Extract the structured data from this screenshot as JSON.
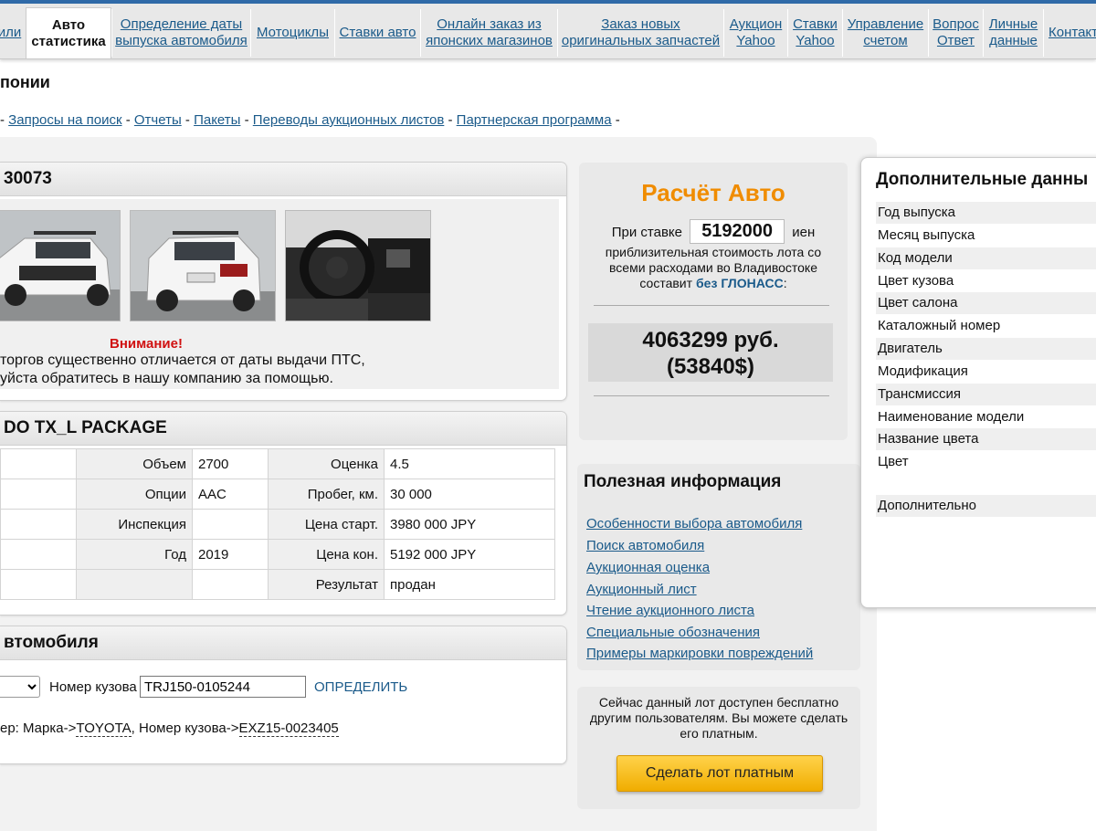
{
  "nav": [
    {
      "label": "или"
    },
    {
      "label": "Авто статистика"
    },
    {
      "label": "Определение даты выпуска автомобиля"
    },
    {
      "label": "Мотоциклы"
    },
    {
      "label": "Ставки авто"
    },
    {
      "label": "Онлайн заказ из японских магазинов"
    },
    {
      "label": "Заказ новых оригинальных запчастей"
    },
    {
      "label": "Аукцион Yahoo"
    },
    {
      "label": "Ставки Yahoo"
    },
    {
      "label": "Управление счетом"
    },
    {
      "label": "Вопрос Ответ"
    },
    {
      "label": "Личные данные"
    },
    {
      "label": "Контакт"
    }
  ],
  "page_title": "понии",
  "subnav": [
    "Запросы на поиск",
    "Отчеты",
    "Пакеты",
    "Переводы аукционных листов",
    "Партнерская программа"
  ],
  "lot": {
    "head": "30073",
    "warning_title": "Внимание!",
    "warning_line1": "торгов существенно отличается от даты выдачи ПТС,",
    "warning_line2": "уйста обратитесь в нашу компанию за помощью."
  },
  "car": {
    "head": "DO TX_L PACKAGE",
    "rows": [
      {
        "l1": "Объем",
        "v1": "2700",
        "l2": "Оценка",
        "v2": "4.5"
      },
      {
        "l1": "Опции",
        "v1": "AAC",
        "l2": "Пробег, км.",
        "v2": "30 000"
      },
      {
        "l1": "Инспекция",
        "v1": "",
        "l2": "Цена старт.",
        "v2": "3980 000 JPY"
      },
      {
        "l1": "Год",
        "v1": "2019",
        "l2": "Цена кон.",
        "v2": "5192 000 JPY"
      },
      {
        "l1": "",
        "v1": "",
        "l2": "Результат",
        "v2": "продан"
      }
    ]
  },
  "vin": {
    "head": "втомобиля",
    "body_label": "Номер кузова",
    "body_value": "TRJ150-0105244",
    "button": "ОПРЕДЕЛИТЬ",
    "example_prefix": "ер: Марка->",
    "example_brand": "TOYOTA",
    "example_mid": ", Номер кузова->",
    "example_body": "EXZ15-0023405"
  },
  "calc": {
    "title": "Расчёт Авто",
    "rate_prefix": "При ставке",
    "rate_value": "5192000",
    "rate_suffix": "иен",
    "desc": "приблизительная стоимость лота со всеми расходами во Владивостоке составит",
    "link": "без ГЛОНАСС",
    "colon": ":",
    "price_rub": "4063299 руб.",
    "price_usd": "(53840$)"
  },
  "useful": {
    "title": "Полезная информация",
    "links": [
      "Особенности выбора автомобиля",
      "Поиск автомобиля",
      "Аукционная оценка",
      "Аукционный лист",
      "Чтение аукционного листа",
      "Специальные обозначения",
      "Примеры маркировки повреждений"
    ]
  },
  "paid": {
    "text": "Сейчас данный лот доступен бесплатно другим пользователям. Вы можете сделать его платным.",
    "button": "Сделать лот платным"
  },
  "extra": {
    "title": "Дополнительные данны",
    "rows": [
      "Год выпуска",
      "Месяц выпуска",
      "Код модели",
      "Цвет кузова",
      "Цвет салона",
      "Каталожный номер",
      "Двигатель",
      "Модификация",
      "Трансмиссия",
      "Наименование модели",
      "Название цвета",
      "Цвет",
      "Дополнительно"
    ]
  }
}
